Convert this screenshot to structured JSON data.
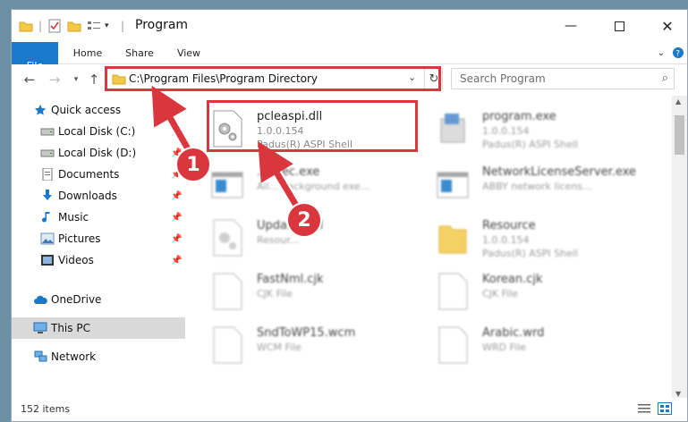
{
  "window": {
    "title": "Program"
  },
  "ribbon": {
    "tabs": [
      "File",
      "Home",
      "Share",
      "View"
    ]
  },
  "address": {
    "path": "C:\\Program Files\\Program Directory"
  },
  "search": {
    "placeholder": "Search Program"
  },
  "sidebar": {
    "items": [
      {
        "label": "Quick access",
        "icon": "star-icon"
      },
      {
        "label": "Local Disk (C:)",
        "icon": "drive-icon"
      },
      {
        "label": "Local Disk (D:)",
        "icon": "drive-icon"
      },
      {
        "label": "Documents",
        "icon": "documents-icon"
      },
      {
        "label": "Downloads",
        "icon": "download-icon"
      },
      {
        "label": "Music",
        "icon": "music-icon"
      },
      {
        "label": "Pictures",
        "icon": "pictures-icon"
      },
      {
        "label": "Videos",
        "icon": "videos-icon"
      },
      {
        "label": "OneDrive",
        "icon": "cloud-icon"
      },
      {
        "label": "This PC",
        "icon": "pc-icon"
      },
      {
        "label": "Network",
        "icon": "network-icon"
      }
    ]
  },
  "files": {
    "pcleaspi": {
      "name": "pcleaspi.dll",
      "version": "1.0.0.154",
      "desc": "Padus(R) ASPI Shell"
    },
    "program": {
      "name": "program.exe",
      "version": "1.0.0.154",
      "desc": "Padus(R) ASPI Shell"
    },
    "backexec": {
      "name": "...Exec.exe",
      "desc": "All... background exe..."
    },
    "netlicense": {
      "name": "NetworkLicenseServer.exe",
      "desc": "ABBY network licens..."
    },
    "update": {
      "name": "Upda...5.dll",
      "desc": "Resour..."
    },
    "resource": {
      "name": "Resource",
      "version": "1.0.0.154",
      "desc": "Padus(R) ASPI Shell"
    },
    "fastnml": {
      "name": "FastNml.cjk",
      "desc": "CJK File"
    },
    "korean": {
      "name": "Korean.cjk",
      "desc": "CJK File"
    },
    "sndtowp": {
      "name": "SndToWP15.wcm",
      "desc": "WCM File"
    },
    "arabic": {
      "name": "Arabic.wrd",
      "desc": "WRD File"
    }
  },
  "status": {
    "item_count": "152 items"
  },
  "badges": {
    "one": "1",
    "two": "2"
  },
  "colors": {
    "accent": "#1979ca",
    "highlight": "#d9363e"
  }
}
